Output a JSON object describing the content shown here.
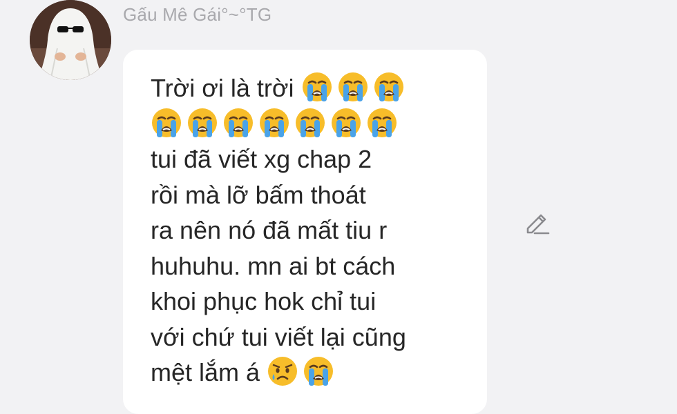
{
  "sender": {
    "name": "Gấu Mê Gái°~°TG",
    "avatar_icon": "ghost-sunglasses-avatar"
  },
  "message": {
    "lines": [
      {
        "text": "Trời ơi là trời",
        "emoji_after": [
          "loudly-crying-face",
          "loudly-crying-face",
          "loudly-crying-face"
        ]
      },
      {
        "text": "",
        "emoji_after": [
          "loudly-crying-face",
          "loudly-crying-face",
          "loudly-crying-face",
          "loudly-crying-face",
          "loudly-crying-face",
          "loudly-crying-face",
          "loudly-crying-face"
        ]
      },
      {
        "text": "tui đã viết xg chap 2",
        "emoji_after": []
      },
      {
        "text": "rồi mà lỡ bấm thoát",
        "emoji_after": []
      },
      {
        "text": "ra nên nó đã mất tiu r",
        "emoji_after": []
      },
      {
        "text": "huhuhu. mn ai bt cách",
        "emoji_after": []
      },
      {
        "text": "khoi phục hok chỉ tui",
        "emoji_after": []
      },
      {
        "text": "với chứ tui viết lại cũng",
        "emoji_after": []
      },
      {
        "text": "mệt lắm á",
        "emoji_after": [
          "crying-face",
          "loudly-crying-face"
        ]
      }
    ]
  },
  "actions": {
    "edit_icon": "pencil-edit-icon"
  },
  "colors": {
    "background": "#f2f2f4",
    "bubble": "#ffffff",
    "text": "#262626",
    "name": "#a9a9ad",
    "icon": "#8a8a8e"
  }
}
